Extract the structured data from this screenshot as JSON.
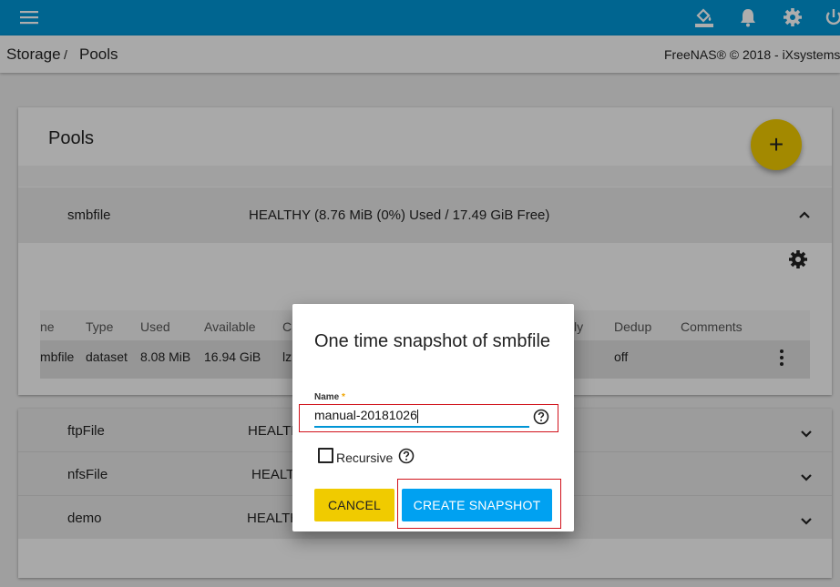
{
  "topbar": {
    "menu_icon": "hamburger-menu-icon",
    "icons": [
      "paint-bucket-icon",
      "bell-icon",
      "gear-icon",
      "power-icon"
    ]
  },
  "breadcrumb": {
    "first": "Storage",
    "sep": "/",
    "second": "Pools"
  },
  "copyright": "FreeNAS® © 2018 - iXsystems,",
  "card": {
    "title": "Pools",
    "fab_label": "+",
    "pool": {
      "name": "smbfile",
      "status": "HEALTHY (8.76 MiB (0%) Used / 17.49 GiB Free)"
    },
    "table": {
      "headers": [
        "ne",
        "Type",
        "Used",
        "Available",
        "C",
        "ly",
        "Dedup",
        "Comments"
      ],
      "row": [
        "mbfile",
        "dataset",
        "8.08 MiB",
        "16.94 GiB",
        "lz",
        "off"
      ]
    },
    "other_pools": [
      {
        "name": "ftpFile",
        "status": "HEALTH"
      },
      {
        "name": "nfsFile",
        "status": "HEALT"
      },
      {
        "name": "demo",
        "status": "HEALTH"
      }
    ]
  },
  "dialog": {
    "title": "One time snapshot of smbfile",
    "name_label": "Name",
    "required_mark": "*",
    "name_value": "manual-20181026",
    "recursive_label": "Recursive",
    "cancel_label": "CANCEL",
    "create_label": "CREATE SNAPSHOT"
  },
  "colors": {
    "topbar": "#0095d5",
    "accent_yellow": "#f0cb00",
    "primary_blue": "#00a1f1",
    "highlight_red": "#d1121b"
  }
}
